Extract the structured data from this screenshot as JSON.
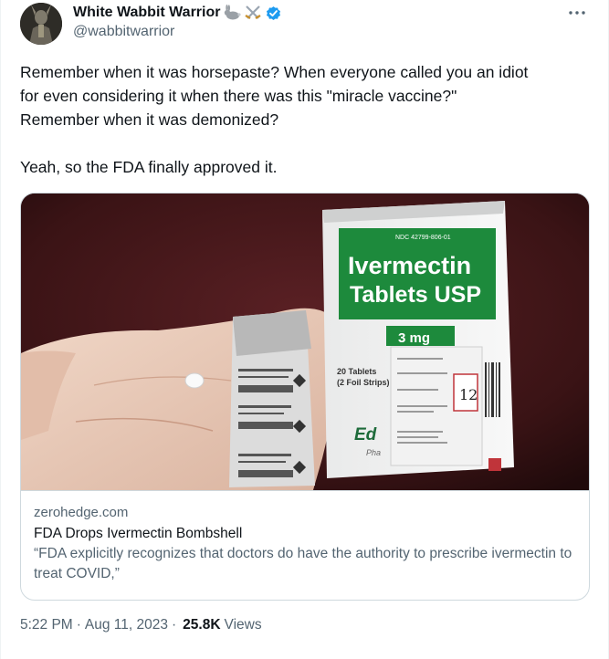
{
  "author": {
    "display_name": "White Wabbit Warrior",
    "handle": "@wabbitwarrior",
    "emoji_icons": [
      "rabbit-emoji",
      "crossed-swords-emoji"
    ],
    "verified_color": "#1d9bf0"
  },
  "tweet": {
    "lines": [
      "Remember when it was horsepaste? When everyone called you an idiot",
      "for even considering it when there was this \"miracle vaccine?\"",
      "Remember when it was demonized?"
    ],
    "last_line": "Yeah, so the FDA finally approved it."
  },
  "card": {
    "image": {
      "box_ndc": "NDC 42799-806-01",
      "drug_name_line1": "Ivermectin",
      "drug_name_line2": "Tablets USP",
      "dose": "3 mg",
      "count_line1": "20 Tablets",
      "count_line2": "(2 Foil Strips)",
      "brand_partial": "Ed",
      "brand_sub_partial": "Pha",
      "handwritten_number": "12"
    },
    "domain": "zerohedge.com",
    "title": "FDA Drops Ivermectin Bombshell",
    "description": "“FDA explicitly recognizes that doctors do have the authority to prescribe ivermectin to treat COVID,”"
  },
  "footer": {
    "time": "5:22 PM",
    "separator": "·",
    "date": "Aug 11, 2023",
    "separator2": "·",
    "views_count": "25.8K",
    "views_label": "Views"
  },
  "colors": {
    "text": "#0f1419",
    "secondary": "#536471",
    "border": "#cfd9de",
    "box_green": "#1d8a3c",
    "hand": "#e8c9b8"
  }
}
